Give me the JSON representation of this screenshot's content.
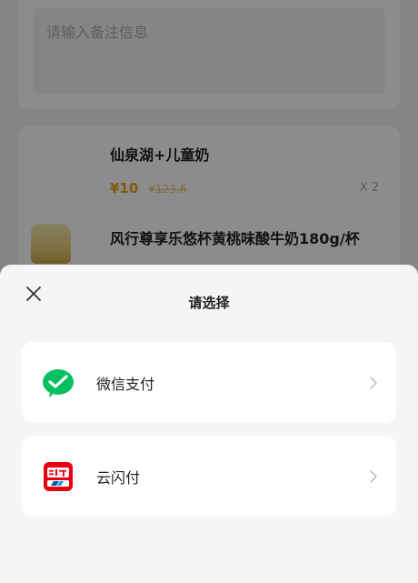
{
  "background": {
    "remark": {
      "placeholder": "请输入备注信息"
    },
    "goods": [
      {
        "name": "仙泉湖+儿童奶",
        "price": "¥10",
        "original_price": "¥123.6",
        "quantity": "X 2"
      },
      {
        "name": "风行尊享乐悠杯黄桃味酸牛奶180g/杯"
      }
    ]
  },
  "sheet": {
    "title": "请选择",
    "close_icon": "close-icon",
    "options": [
      {
        "label": "微信支付",
        "icon": "wechat-pay-icon",
        "color": "#07c160"
      },
      {
        "label": "云闪付",
        "icon": "unionpay-icon",
        "color": "#e60012"
      }
    ]
  }
}
